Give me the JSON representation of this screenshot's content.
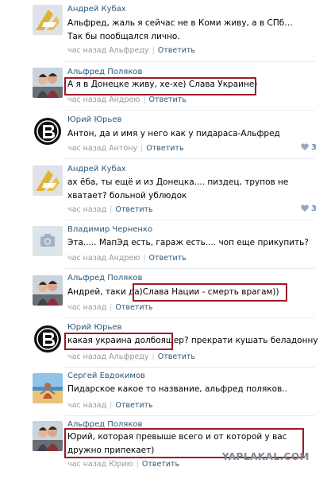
{
  "comments": [
    {
      "author": "Андрей Кубах",
      "text": "Альфред, жаль я сейчас не в Коми живу, а в СПб… Так бы пообщался лично.",
      "time": "час назад Альфреду",
      "reply": "Ответить",
      "likes": ""
    },
    {
      "author": "Альфред Поляков",
      "text": "А я в Донецке живу, хе-хе) Слава Украине)",
      "time": "час назад Андрею",
      "reply": "Ответить",
      "likes": ""
    },
    {
      "author": "Юрий Юрьев",
      "text": "Антон, да и имя у него как у пидараса-Альфред",
      "time": "час назад Антону",
      "reply": "Ответить",
      "likes": "3"
    },
    {
      "author": "Андрей Кубах",
      "text": "ах ёба, ты ещё и из Донецка.... пиздец, трупов не хватает? больной ублюдок",
      "time": "час назад",
      "reply": "Ответить",
      "likes": "3"
    },
    {
      "author": "Владимир Черненко",
      "text": "Эта..... МапЭд есть, гараж есть.... чоп еще прикупить?",
      "time": "час назад Андрею",
      "reply": "Ответить",
      "likes": ""
    },
    {
      "author": "Альфред Поляков",
      "text_a": "Андрей, таки да)",
      "text_b": "Слава Нации - смерть врагам))",
      "time": "час назад",
      "reply": "Ответить",
      "likes": ""
    },
    {
      "author": "Юрий Юрьев",
      "text_a": "какая украина долбоящер?",
      "text_b": "прекрати кушать беладонну",
      "time": "час назад Альфреду",
      "reply": "Ответить",
      "likes": ""
    },
    {
      "author": "Сергей Евдокимов",
      "text": "Пидарское какое то название, альфред поляков..",
      "time": "час назад",
      "reply": "Ответить",
      "likes": ""
    },
    {
      "author": "Альфред Поляков",
      "text": "Юрий, которая превыше всего и от которой у вас дружно припекает)",
      "time": "час назад Юрию",
      "reply": "Ответить",
      "likes": ""
    }
  ],
  "watermark": "YAPLAKAL.COM",
  "colors": {
    "author": "#2b587a",
    "meta": "#999999",
    "highlight_box": "#a0182a",
    "likes": "#6c8fb3"
  },
  "icons": {
    "avatar_kubah": "yellow-arrow-logo",
    "avatar_polyakov": "couple-photo",
    "avatar_yuriev": "black-b-logo",
    "avatar_chernenko": "camera-placeholder",
    "avatar_evdokimov": "beach-photo",
    "like": "heart-icon"
  }
}
